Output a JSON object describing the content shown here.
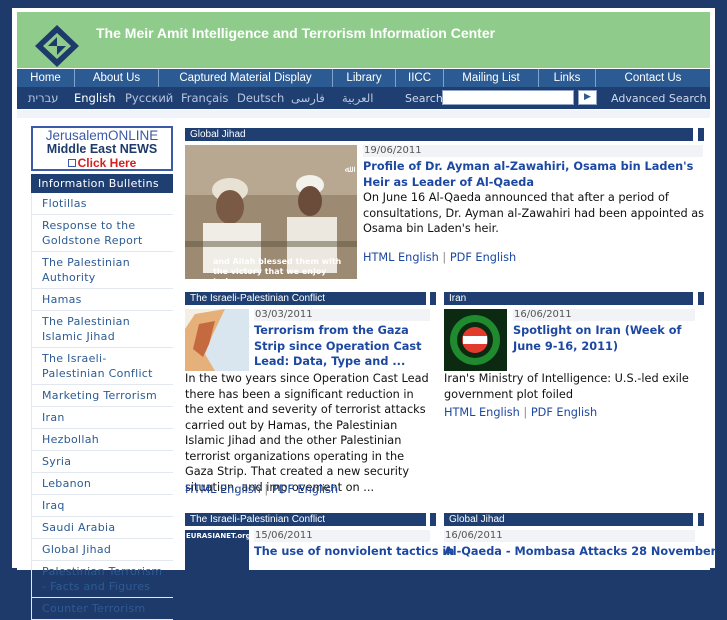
{
  "site": {
    "title": "The Meir Amit Intelligence and Terrorism Information Center"
  },
  "nav": [
    {
      "label": "Home",
      "w": 58
    },
    {
      "label": "About Us",
      "w": 84
    },
    {
      "label": "Captured Material Display",
      "w": 174
    },
    {
      "label": "Library",
      "w": 63
    },
    {
      "label": "IICC",
      "w": 48
    },
    {
      "label": "Mailing List",
      "w": 95
    },
    {
      "label": "Links",
      "w": 57
    },
    {
      "label": "Contact Us",
      "w": 114
    }
  ],
  "languages": [
    "עברית",
    "English",
    "Русский",
    "Français",
    "Deutsch",
    "فارسی",
    "العربية"
  ],
  "search": {
    "label": "Search",
    "button": "▶",
    "advanced": "Advanced Search"
  },
  "sidebar": {
    "jol": {
      "brand_a": "Jerusalem",
      "brand_b": "ONLINE",
      "sub": "Middle East NEWS",
      "click": "Click Here"
    },
    "heading": "Information Bulletins",
    "items": [
      "Flotillas",
      "Response to the Goldstone Report",
      "The Palestinian Authority",
      "Hamas",
      "The Palestinian Islamic Jihad",
      "The Israeli-Palestinian Conflict",
      "Marketing Terrorism",
      "Iran",
      "Hezbollah",
      "Syria",
      "Lebanon",
      "Iraq",
      "Saudi Arabia",
      "Global Jihad",
      "Palestinian Terrorism - Facts and Figures",
      "Counter Terrorism"
    ]
  },
  "featured": {
    "section": "Global Jihad",
    "date": "19/06/2011",
    "headline": "Profile of Dr. Ayman al-Zawahiri, Osama bin Laden's Heir as Leader of Al-Qaeda",
    "body": "On June 16 Al-Qaeda announced that after a period of consultations, Dr. Ayman al-Zawahiri had been appointed as Osama bin Laden's heir.",
    "caption": "and Allah blessed them with the victory that we enjoy today.",
    "link_html": "HTML English",
    "link_pdf": "PDF English"
  },
  "article_left": {
    "section": "The Israeli-Palestinian Conflict",
    "date": "03/03/2011",
    "headline": "Terrorism from the Gaza Strip since Operation Cast Lead: Data, Type and ...",
    "body": "In the two years since Operation Cast Lead there has been a significant reduction in the extent and severity of terrorist attacks carried out by Hamas, the Palestinian Islamic Jihad and the other Palestinian terrorist organizations operating in the Gaza Strip. That created a new security situation, and improvement on ...",
    "link_html": "HTML English",
    "link_pdf": "PDF English"
  },
  "article_right": {
    "section": "Iran",
    "date": "16/06/2011",
    "headline": "Spotlight on Iran (Week of June 9-16, 2011)",
    "body": "Iran's Ministry of Intelligence: U.S.-led exile government plot foiled",
    "link_html": "HTML English",
    "link_pdf": "PDF English"
  },
  "article_bottom_left": {
    "section": "The Israeli-Palestinian Conflict",
    "date": "15/06/2011",
    "thumb_label": "EURASIANET.org",
    "headline": "The use of nonviolent tactics in"
  },
  "article_bottom_right": {
    "section": "Global Jihad",
    "date": "16/06/2011",
    "headline": "Al-Qaeda - Mombasa Attacks 28 November"
  },
  "colors": {
    "header_green": "#8fcc8b",
    "nav_blue": "#2c5b93",
    "dark_blue": "#1f3f72",
    "link_blue": "#1d48a2"
  }
}
